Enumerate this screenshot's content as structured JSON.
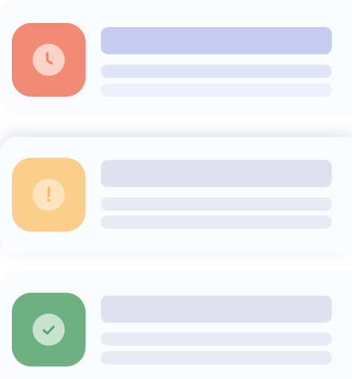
{
  "colors": {
    "card_background": "#fbfcfe",
    "clock_tile": "#f28b76",
    "clock_badge": "#fbd3c9",
    "clock_glyph": "#ef8268",
    "clock_title_bar": "#c7cdf0",
    "clock_line_1": "#e2e5f6",
    "clock_line_2": "#eef0fa",
    "warning_tile": "#fdcf8d",
    "warning_badge": "#fee4bf",
    "warning_glyph": "#f8b961",
    "neutral_title_bar": "#dfe1ee",
    "neutral_line": "#e9eaf3",
    "success_tile": "#6fb083",
    "success_badge": "#c9e3d1",
    "success_glyph": "#5ea573"
  },
  "cards": [
    {
      "status": "pending",
      "icon": "clock-icon"
    },
    {
      "status": "warning",
      "icon": "exclamation-icon"
    },
    {
      "status": "success",
      "icon": "checkmark-icon"
    }
  ]
}
